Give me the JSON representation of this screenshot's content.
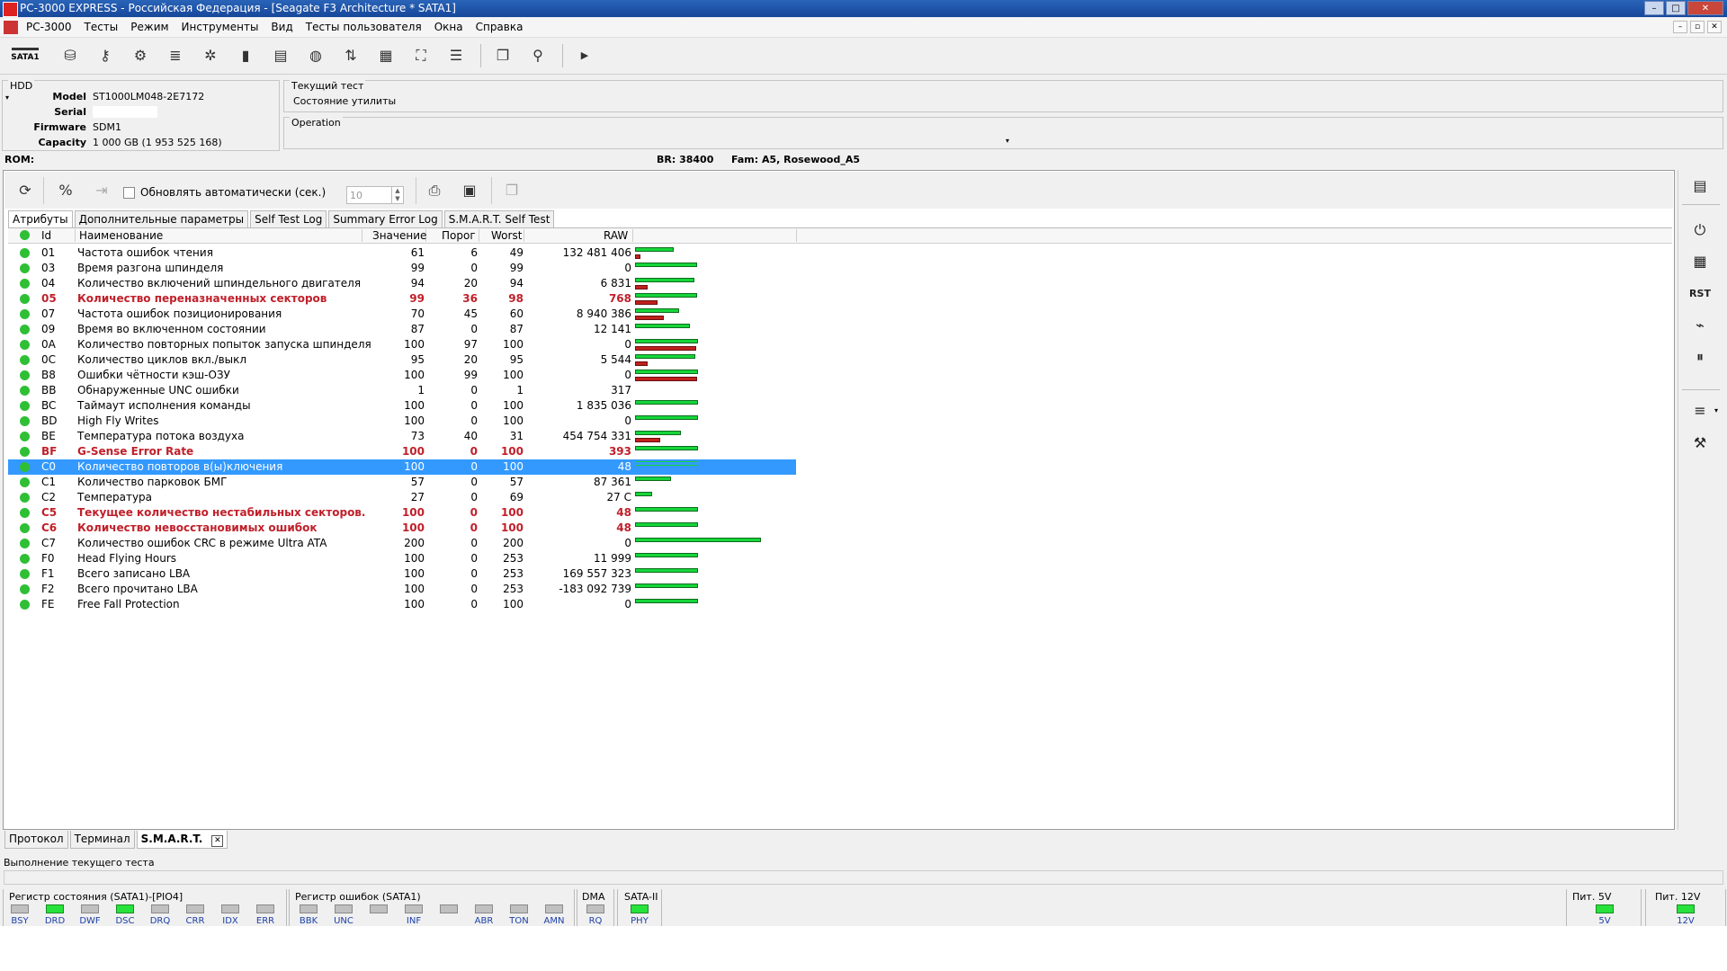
{
  "window": {
    "title": "PC-3000 EXPRESS - Российская Федерация - [Seagate F3 Architecture * SATA1]"
  },
  "menu": [
    "PC-3000",
    "Тесты",
    "Режим",
    "Инструменты",
    "Вид",
    "Тесты пользователя",
    "Окна",
    "Справка"
  ],
  "toolbar": {
    "sata_label": "SATA1",
    "icons": [
      "head-map-icon",
      "key-icon",
      "drive-config-icon",
      "speed-9600-icon",
      "chip-settings-icon",
      "memory-chip-icon",
      "log-icon",
      "disk-icon",
      "transfer-icon",
      "grid-icon",
      "network-icon",
      "list-icon",
      "windows-icon",
      "person-icon",
      "play-icon"
    ]
  },
  "hdd": {
    "group_title": "HDD",
    "model_label": "Model",
    "model": "ST1000LM048-2E7172",
    "serial_label": "Serial",
    "serial": "",
    "firmware_label": "Firmware",
    "firmware": "SDM1",
    "capacity_label": "Capacity",
    "capacity": "1 000 GB (1 953 525 168)"
  },
  "current_test": {
    "group_title": "Текущий тест",
    "value": "Состояние утилиты"
  },
  "operation": {
    "group_title": "Operation"
  },
  "rom_line": {
    "rom": "ROM:",
    "br": "BR: 38400",
    "fam": "Fam: A5, Rosewood_A5"
  },
  "smart_toolbar": {
    "auto_refresh_label": "Обновлять автоматически (сек.)",
    "auto_refresh_value": "10"
  },
  "tabs": [
    "Атрибуты",
    "Дополнительные параметры",
    "Self Test Log",
    "Summary Error Log",
    "S.M.A.R.T. Self Test"
  ],
  "columns": {
    "id": "Id",
    "name": "Наименование",
    "value": "Значение",
    "threshold": "Порог",
    "worst": "Worst",
    "raw": "RAW"
  },
  "attributes": [
    {
      "id": "01",
      "name": "Частота ошибок чтения",
      "value": "61",
      "threshold": "6",
      "worst": "49",
      "raw": "132 481 406",
      "red": false,
      "selected": false,
      "green": 0.61,
      "redbar": 0.06
    },
    {
      "id": "03",
      "name": "Время разгона шпинделя",
      "value": "99",
      "threshold": "0",
      "worst": "99",
      "raw": "0",
      "red": false,
      "selected": false,
      "green": 0.99,
      "redbar": 0
    },
    {
      "id": "04",
      "name": "Количество включений шпиндельного двигателя",
      "value": "94",
      "threshold": "20",
      "worst": "94",
      "raw": "6 831",
      "red": false,
      "selected": false,
      "green": 0.94,
      "redbar": 0.2
    },
    {
      "id": "05",
      "name": "Количество переназначенных секторов",
      "value": "99",
      "threshold": "36",
      "worst": "98",
      "raw": "768",
      "red": true,
      "selected": false,
      "green": 0.99,
      "redbar": 0.36
    },
    {
      "id": "07",
      "name": "Частота ошибок позиционирования",
      "value": "70",
      "threshold": "45",
      "worst": "60",
      "raw": "8 940 386",
      "red": false,
      "selected": false,
      "green": 0.7,
      "redbar": 0.45
    },
    {
      "id": "09",
      "name": "Время во включенном состоянии",
      "value": "87",
      "threshold": "0",
      "worst": "87",
      "raw": "12 141",
      "red": false,
      "selected": false,
      "green": 0.87,
      "redbar": 0
    },
    {
      "id": "0A",
      "name": "Количество повторных попыток запуска шпинделя",
      "value": "100",
      "threshold": "97",
      "worst": "100",
      "raw": "0",
      "red": false,
      "selected": false,
      "green": 1.0,
      "redbar": 0.97
    },
    {
      "id": "0C",
      "name": "Количество циклов вкл./выкл",
      "value": "95",
      "threshold": "20",
      "worst": "95",
      "raw": "5 544",
      "red": false,
      "selected": false,
      "green": 0.95,
      "redbar": 0.2
    },
    {
      "id": "B8",
      "name": "Ошибки чётности кэш-ОЗУ",
      "value": "100",
      "threshold": "99",
      "worst": "100",
      "raw": "0",
      "red": false,
      "selected": false,
      "green": 1.0,
      "redbar": 0.99
    },
    {
      "id": "BB",
      "name": "Обнаруженные UNC ошибки",
      "value": "1",
      "threshold": "0",
      "worst": "1",
      "raw": "317",
      "red": false,
      "selected": false,
      "green": 0,
      "redbar": 0
    },
    {
      "id": "BC",
      "name": "Таймаут исполнения команды",
      "value": "100",
      "threshold": "0",
      "worst": "100",
      "raw": "1 835 036",
      "red": false,
      "selected": false,
      "green": 1.0,
      "redbar": 0
    },
    {
      "id": "BD",
      "name": "High Fly Writes",
      "value": "100",
      "threshold": "0",
      "worst": "100",
      "raw": "0",
      "red": false,
      "selected": false,
      "green": 1.0,
      "redbar": 0
    },
    {
      "id": "BE",
      "name": "Температура потока воздуха",
      "value": "73",
      "threshold": "40",
      "worst": "31",
      "raw": "454 754 331",
      "red": false,
      "selected": false,
      "green": 0.73,
      "redbar": 0.4
    },
    {
      "id": "BF",
      "name": "G-Sense Error Rate",
      "value": "100",
      "threshold": "0",
      "worst": "100",
      "raw": "393",
      "red": true,
      "selected": false,
      "green": 1.0,
      "redbar": 0
    },
    {
      "id": "C0",
      "name": "Количество повторов в(ы)ключения",
      "value": "100",
      "threshold": "0",
      "worst": "100",
      "raw": "48",
      "red": false,
      "selected": true,
      "green": 1.0,
      "redbar": 0
    },
    {
      "id": "C1",
      "name": "Количество парковок БМГ",
      "value": "57",
      "threshold": "0",
      "worst": "57",
      "raw": "87 361",
      "red": false,
      "selected": false,
      "green": 0.57,
      "redbar": 0
    },
    {
      "id": "C2",
      "name": "Температура",
      "value": "27",
      "threshold": "0",
      "worst": "69",
      "raw": "27 C",
      "red": false,
      "selected": false,
      "green": 0.27,
      "redbar": 0
    },
    {
      "id": "C5",
      "name": "Текущее количество нестабильных секторов.",
      "value": "100",
      "threshold": "0",
      "worst": "100",
      "raw": "48",
      "red": true,
      "selected": false,
      "green": 1.0,
      "redbar": 0
    },
    {
      "id": "C6",
      "name": "Количество невосстановимых ошибок",
      "value": "100",
      "threshold": "0",
      "worst": "100",
      "raw": "48",
      "red": true,
      "selected": false,
      "green": 1.0,
      "redbar": 0
    },
    {
      "id": "C7",
      "name": "Количество ошибок CRC в режиме Ultra ATA",
      "value": "200",
      "threshold": "0",
      "worst": "200",
      "raw": "0",
      "red": false,
      "selected": false,
      "green": 2.0,
      "redbar": 0
    },
    {
      "id": "F0",
      "name": "Head Flying Hours",
      "value": "100",
      "threshold": "0",
      "worst": "253",
      "raw": "11 999",
      "red": false,
      "selected": false,
      "green": 1.0,
      "redbar": 0
    },
    {
      "id": "F1",
      "name": "Всего записано LBA",
      "value": "100",
      "threshold": "0",
      "worst": "253",
      "raw": "169 557 323",
      "red": false,
      "selected": false,
      "green": 1.0,
      "redbar": 0
    },
    {
      "id": "F2",
      "name": "Всего прочитано LBA",
      "value": "100",
      "threshold": "0",
      "worst": "253",
      "raw": "-183 092 739",
      "red": false,
      "selected": false,
      "green": 1.0,
      "redbar": 0
    },
    {
      "id": "FE",
      "name": "Free Fall Protection",
      "value": "100",
      "threshold": "0",
      "worst": "100",
      "raw": "0",
      "red": false,
      "selected": false,
      "green": 1.0,
      "redbar": 0
    }
  ],
  "bottom_tabs": [
    "Протокол",
    "Терминал",
    "S.M.A.R.T."
  ],
  "status": {
    "current_test_label": "Выполнение текущего теста"
  },
  "registers": {
    "state_title": "Регистр состояния (SATA1)-[PIO4]",
    "state_leds": [
      {
        "label": "BSY",
        "on": false
      },
      {
        "label": "DRD",
        "on": true
      },
      {
        "label": "DWF",
        "on": false
      },
      {
        "label": "DSC",
        "on": true
      },
      {
        "label": "DRQ",
        "on": false
      },
      {
        "label": "CRR",
        "on": false
      },
      {
        "label": "IDX",
        "on": false
      },
      {
        "label": "ERR",
        "on": false
      }
    ],
    "error_title": "Регистр ошибок  (SATA1)",
    "error_leds": [
      {
        "label": "BBK",
        "on": false
      },
      {
        "label": "UNC",
        "on": false
      },
      {
        "label": "",
        "on": false
      },
      {
        "label": "INF",
        "on": false
      },
      {
        "label": "",
        "on": false
      },
      {
        "label": "ABR",
        "on": false
      },
      {
        "label": "TON",
        "on": false
      },
      {
        "label": "AMN",
        "on": false
      }
    ],
    "dma_title": "DMA",
    "dma_led": {
      "label": "RQ",
      "on": false
    },
    "sata_title": "SATA-II",
    "sata_led": {
      "label": "PHY",
      "on": true
    },
    "power5_title": "Пит. 5V",
    "power5_led": {
      "label": "5V",
      "on": true
    },
    "power12_title": "Пит. 12V",
    "power12_led": {
      "label": "12V",
      "on": true
    }
  },
  "colors": {
    "selected_row": "#3399ff",
    "red_text": "#c0202a",
    "green_bar": "#16d63a",
    "red_bar": "#c0201e"
  }
}
